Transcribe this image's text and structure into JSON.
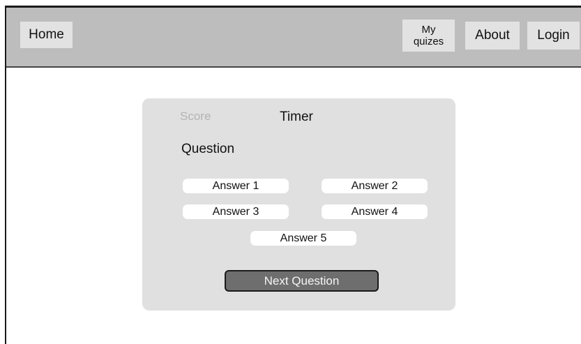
{
  "nav": {
    "home": "Home",
    "my_quizes_line1": "My",
    "my_quizes_line2": "quizes",
    "about": "About",
    "login": "Login"
  },
  "quiz": {
    "score_label": "Score",
    "timer_label": "Timer",
    "question": "Question",
    "answers": [
      "Answer 1",
      "Answer 2",
      "Answer 3",
      "Answer 4",
      "Answer 5"
    ],
    "next_button": "Next Question"
  }
}
